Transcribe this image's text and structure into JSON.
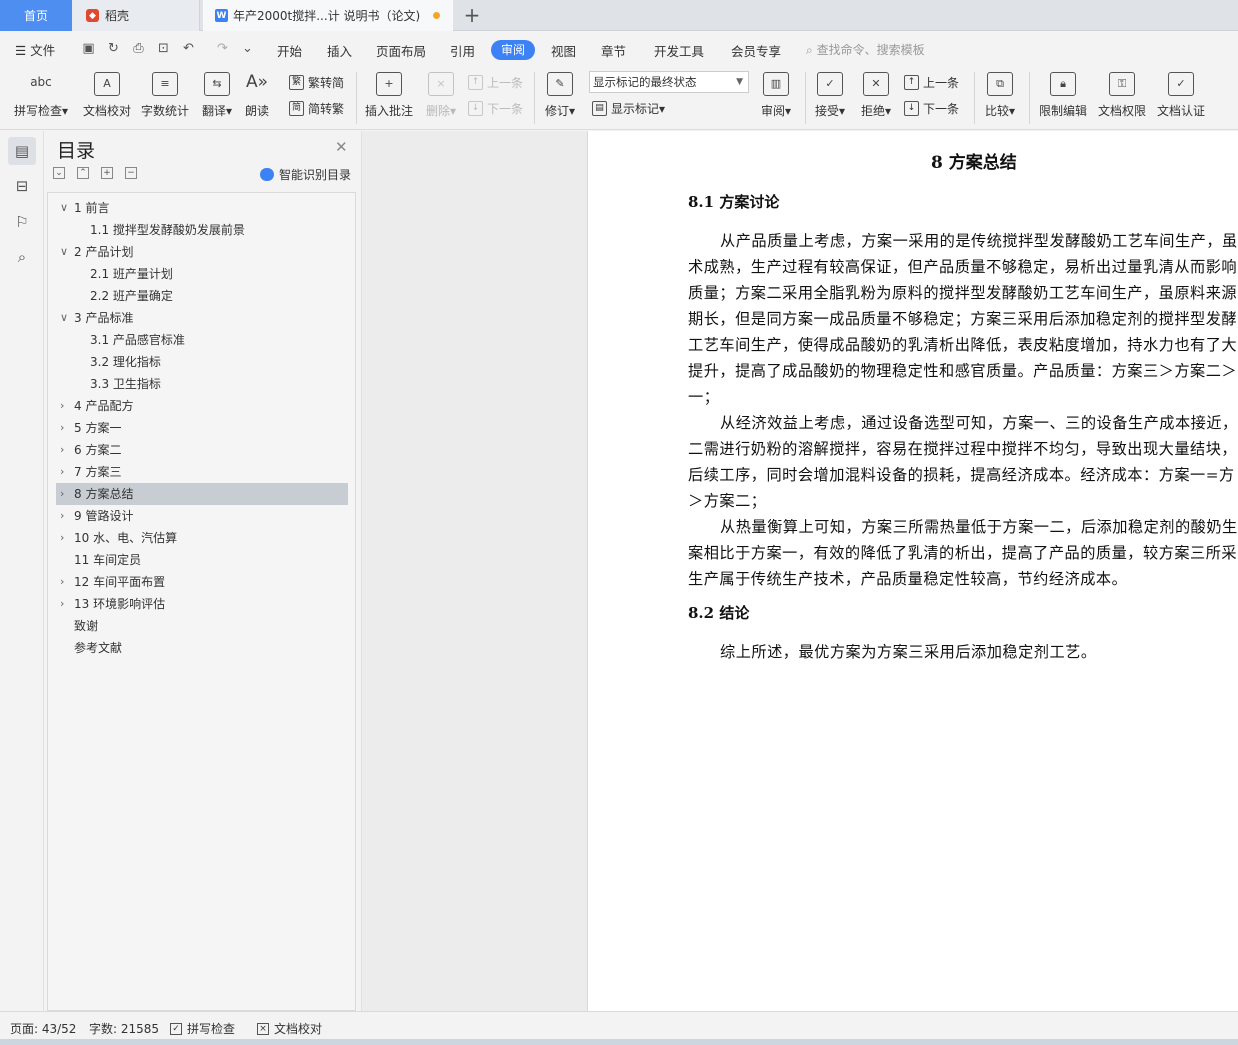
{
  "tabs": {
    "home": "首页",
    "doke": "稻壳",
    "doc_title": "年产2000t搅拌...计 说明书（论文)",
    "add": "+"
  },
  "menu": {
    "file": "文件",
    "items": [
      "开始",
      "插入",
      "页面布局",
      "引用",
      "审阅",
      "视图",
      "章节",
      "开发工具",
      "会员专享"
    ],
    "active": "审阅",
    "search_placeholder": "查找命令、搜索模板"
  },
  "ribbon": {
    "spell_check": "拼写检查",
    "doc_proof": "文档校对",
    "word_count": "字数统计",
    "translate": "翻译",
    "read_aloud": "朗读",
    "to_traditional": "繁转简",
    "to_simplified": "简转繁",
    "insert_comment": "插入批注",
    "delete": "删除",
    "prev_comment": "上一条",
    "next_comment": "下一条",
    "revise": "修订",
    "markup_state": "显示标记的最终状态",
    "show_markup": "显示标记",
    "review": "审阅",
    "accept": "接受",
    "reject": "拒绝",
    "prev_change": "上一条",
    "next_change": "下一条",
    "compare": "比较",
    "restrict_edit": "限制编辑",
    "doc_permission": "文档权限",
    "doc_auth": "文档认证"
  },
  "toc": {
    "title": "目录",
    "smart_label": "智能识别目录",
    "items": [
      {
        "text": "1   前言",
        "level": 1,
        "chev": "∨"
      },
      {
        "text": "1.1 搅拌型发酵酸奶发展前景",
        "level": 2,
        "chev": ""
      },
      {
        "text": "2   产品计划",
        "level": 1,
        "chev": "∨"
      },
      {
        "text": "2.1 班产量计划",
        "level": 2,
        "chev": ""
      },
      {
        "text": "2.2 班产量确定",
        "level": 2,
        "chev": ""
      },
      {
        "text": "3   产品标准",
        "level": 1,
        "chev": "∨"
      },
      {
        "text": "3.1   产品感官标准",
        "level": 2,
        "chev": ""
      },
      {
        "text": "3.2   理化指标",
        "level": 2,
        "chev": ""
      },
      {
        "text": "3.3 卫生指标",
        "level": 2,
        "chev": ""
      },
      {
        "text": "4   产品配方",
        "level": 1,
        "chev": "›"
      },
      {
        "text": "5   方案一",
        "level": 1,
        "chev": "›"
      },
      {
        "text": "6   方案二",
        "level": 1,
        "chev": "›"
      },
      {
        "text": "7   方案三",
        "level": 1,
        "chev": "›"
      },
      {
        "text": "8   方案总结",
        "level": 1,
        "chev": "›",
        "selected": true
      },
      {
        "text": "9   管路设计",
        "level": 1,
        "chev": "›"
      },
      {
        "text": "10   水、电、汽估算",
        "level": 1,
        "chev": "›"
      },
      {
        "text": "11   车间定员",
        "level": 1,
        "chev": ""
      },
      {
        "text": "12   车间平面布置",
        "level": 1,
        "chev": "›"
      },
      {
        "text": "13   环境影响评估",
        "level": 1,
        "chev": "›"
      },
      {
        "text": "致谢",
        "level": 0,
        "chev": ""
      },
      {
        "text": "参考文献",
        "level": 0,
        "chev": ""
      }
    ]
  },
  "document": {
    "heading": "8    方案总结",
    "sec1_heading": "8.1    方案讨论",
    "sec1_lines": [
      "从产品质量上考虑，方案一采用的是传统搅拌型发酵酸奶工艺车间生产，虽",
      "术成熟，生产过程有较高保证，但产品质量不够稳定，易析出过量乳清从而影响",
      "质量；方案二采用全脂乳粉为原料的搅拌型发酵酸奶工艺车间生产，虽原料来源",
      "期长，但是同方案一成品质量不够稳定；方案三采用后添加稳定剂的搅拌型发酵",
      "工艺车间生产，使得成品酸奶的乳清析出降低，表皮粘度增加，持水力也有了大",
      "提升，提高了成品酸奶的物理稳定性和感官质量。产品质量：方案三＞方案二＞",
      "一；",
      "从经济效益上考虑，通过设备选型可知，方案一、三的设备生产成本接近，",
      "二需进行奶粉的溶解搅拌，容易在搅拌过程中搅拌不均匀，导致出现大量结块，",
      "后续工序，同时会增加混料设备的损耗，提高经济成本。经济成本：方案一=方",
      "＞方案二；",
      "从热量衡算上可知，方案三所需热量低于方案一二，后添加稳定剂的酸奶生",
      "案相比于方案一，有效的降低了乳清的析出，提高了产品的质量，较方案三所采",
      "生产属于传统生产技术，产品质量稳定性较高，节约经济成本。"
    ],
    "sec2_heading": "8.2    结论",
    "sec2_line": "综上所述，最优方案为方案三采用后添加稳定剂工艺。"
  },
  "status": {
    "page": "页面: 43/52",
    "words": "字数: 21585",
    "spell": "拼写检查",
    "proof": "文档校对"
  },
  "colors": {
    "accent": "#3d82f5",
    "home_tab": "#4d8ef0",
    "toc_selected": "#c8cdd3"
  }
}
